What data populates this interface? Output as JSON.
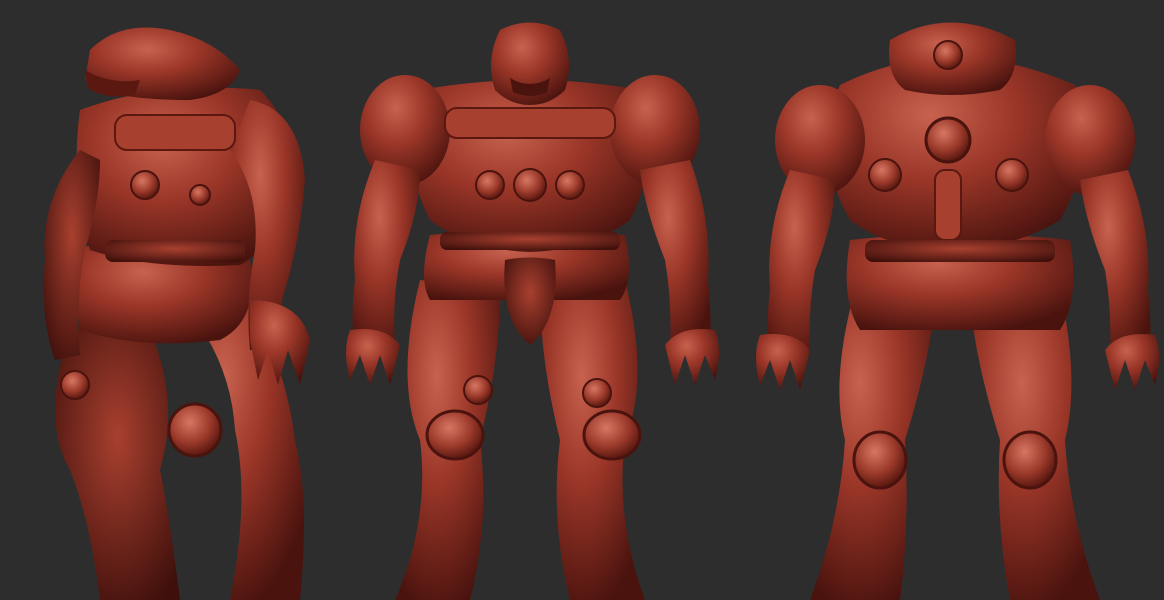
{
  "scene": {
    "background_color": "#2d2d2d",
    "material_color": "#8a2e25",
    "material_highlight": "#c8624f",
    "material_shadow": "#3e0f0b",
    "views": [
      {
        "view": "three-quarter"
      },
      {
        "view": "front"
      },
      {
        "view": "back"
      }
    ]
  }
}
